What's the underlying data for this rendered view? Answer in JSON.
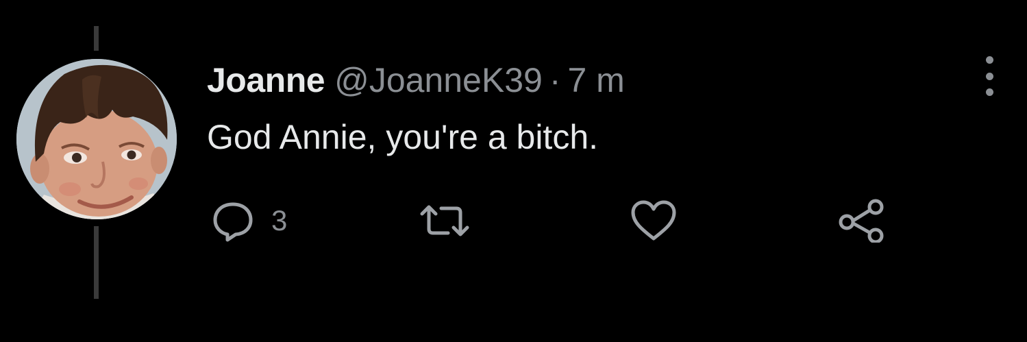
{
  "tweet": {
    "display_name": "Joanne",
    "handle": "@JoanneK39",
    "separator": "·",
    "time": "7 m",
    "text": "God Annie, you're a bitch.",
    "avatar": "profile-photo"
  },
  "actions": {
    "reply": {
      "icon": "reply-bubble-icon",
      "count": "3"
    },
    "retweet": {
      "icon": "retweet-icon",
      "count": ""
    },
    "like": {
      "icon": "heart-icon",
      "count": ""
    },
    "share": {
      "icon": "share-icon",
      "count": ""
    }
  },
  "menu": {
    "icon": "vertical-more-icon"
  },
  "colors": {
    "background": "#000000",
    "primary_text": "#e7e9ea",
    "secondary_text": "#8b8f94",
    "thread_line": "#3a3a3a"
  }
}
